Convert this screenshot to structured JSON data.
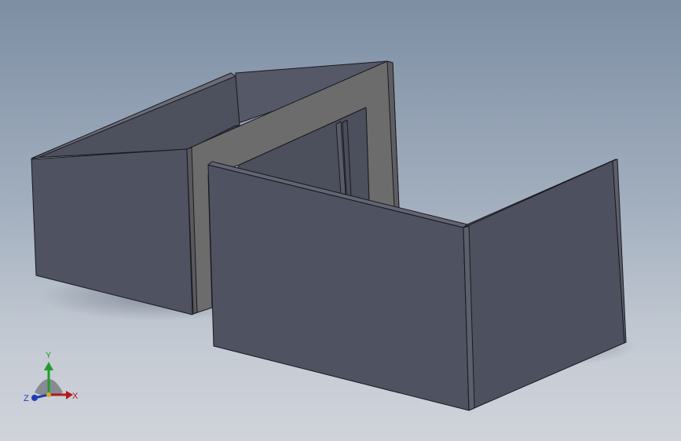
{
  "viewport": {
    "background_top": "#7d8ea3",
    "background_bottom": "#d0d3da"
  },
  "model": {
    "face_color": "#4f5260",
    "face_dark_color": "#464956",
    "face_light_color": "#5b5e6c",
    "rim_color": "#6c6c6c",
    "edge_color": "#1a1a1f",
    "shadow_color": "#5f6677"
  },
  "triad": {
    "x_label": "X",
    "y_label": "Y",
    "z_label": "Z",
    "x_color": "#b3191c",
    "y_color": "#1f9c2a",
    "z_color": "#1c3fb0",
    "cone_color": "#7a7f88"
  }
}
